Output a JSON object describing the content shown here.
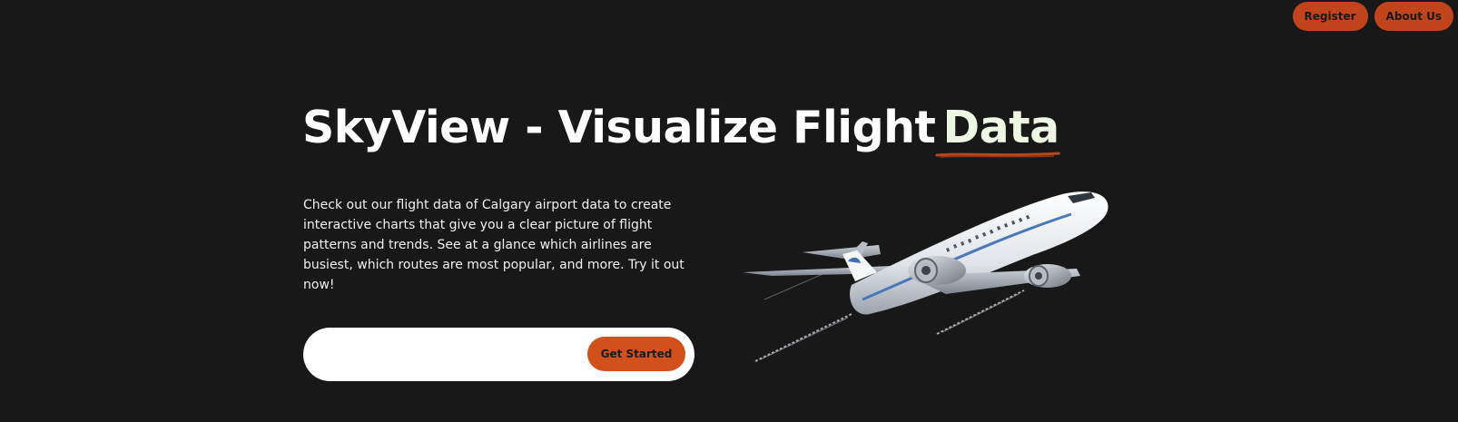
{
  "nav": {
    "register_label": "Register",
    "about_label": "About Us"
  },
  "hero": {
    "title_main": "SkyView - Visualize Flight",
    "title_highlight": "Data",
    "description": "Check out our flight data of Calgary airport data to create interactive charts that give you a clear picture of flight patterns and trends. See at a glance which airlines are busiest, which routes are most popular, and more. Try it out now!",
    "search_placeholder": "",
    "cta_label": "Get Started"
  },
  "colors": {
    "background": "#181818",
    "accent": "#c2441c",
    "cta": "#d1501c",
    "highlight_text": "#eef6e4"
  },
  "icons": {
    "hero_image": "airplane-illustration"
  }
}
